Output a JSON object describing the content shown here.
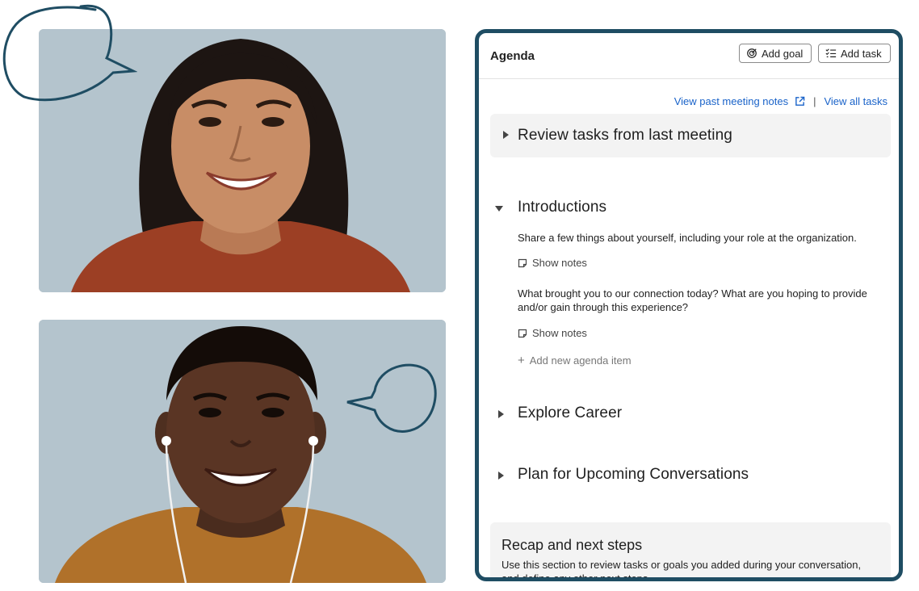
{
  "colors": {
    "panel_border": "#1f4d63",
    "link": "#1a63c9",
    "photo_background": "#b4c4cd"
  },
  "agenda": {
    "title": "Agenda",
    "add_goal_label": "Add goal",
    "add_task_label": "Add task",
    "view_past_notes_label": "View past meeting notes",
    "view_all_tasks_label": "View all tasks",
    "sections": {
      "review": {
        "title": "Review tasks from last meeting",
        "expanded": false
      },
      "introductions": {
        "title": "Introductions",
        "expanded": true,
        "items": [
          {
            "text": "Share a few things about yourself, including your role at the organization.",
            "notes_label": "Show notes"
          },
          {
            "text": "What brought you to our connection today? What are you hoping to provide and/or gain through this experience?",
            "notes_label": "Show notes"
          }
        ],
        "add_item_label": "Add new agenda item"
      },
      "explore": {
        "title": "Explore Career",
        "expanded": false
      },
      "plan": {
        "title": "Plan for Upcoming Conversations",
        "expanded": false
      },
      "recap": {
        "title": "Recap and next steps",
        "description": "Use this section to review tasks or goals you added during your conversation, and define any other next steps."
      }
    }
  },
  "icons": {
    "add_goal": "target-icon",
    "add_task": "checklist-icon",
    "external_link": "external-link-icon",
    "notes": "note-icon",
    "add": "plus-icon",
    "collapsed": "caret-right-icon",
    "expanded": "caret-down-icon"
  }
}
